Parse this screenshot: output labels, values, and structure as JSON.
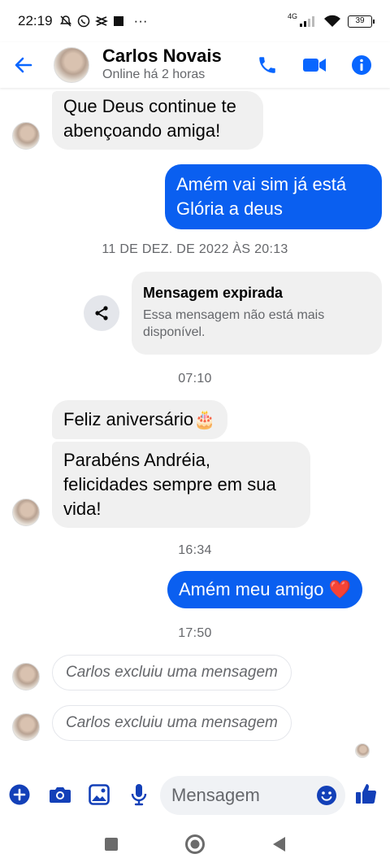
{
  "status_bar": {
    "time": "22:19",
    "extra": "···",
    "network": "4G",
    "battery": "39"
  },
  "header": {
    "contact_name": "Carlos Novais",
    "contact_status": "Online há 2 horas"
  },
  "messages": {
    "m1": "Que Deus continue te abençoando amiga!",
    "m2": "Amém  vai sim já está Glória a deus",
    "ts1": "11 DE DEZ. DE 2022 ÀS 20:13",
    "expired_title": "Mensagem expirada",
    "expired_desc": "Essa mensagem não está mais disponível.",
    "ts2": "07:10",
    "m3": "Feliz aniversário🎂",
    "m4": "Parabéns Andréia, felicidades sempre em sua vida!",
    "ts3": "16:34",
    "m5": "Amém meu amigo ❤️",
    "ts4": "17:50",
    "deleted1": "Carlos excluiu uma mensagem",
    "deleted2": "Carlos excluiu uma mensagem"
  },
  "composer": {
    "placeholder": "Mensagem"
  },
  "colors": {
    "accent": "#0a5ff0",
    "icon_blue": "#0866ff",
    "composer_icon": "#1340b8",
    "incoming_bubble": "#f0f0f0"
  },
  "icons": [
    "back-arrow-icon",
    "phone-icon",
    "video-icon",
    "info-icon",
    "share-icon",
    "plus-icon",
    "camera-icon",
    "image-icon",
    "mic-icon",
    "emoji-icon",
    "like-icon",
    "recents-icon",
    "home-icon",
    "back-nav-icon"
  ]
}
